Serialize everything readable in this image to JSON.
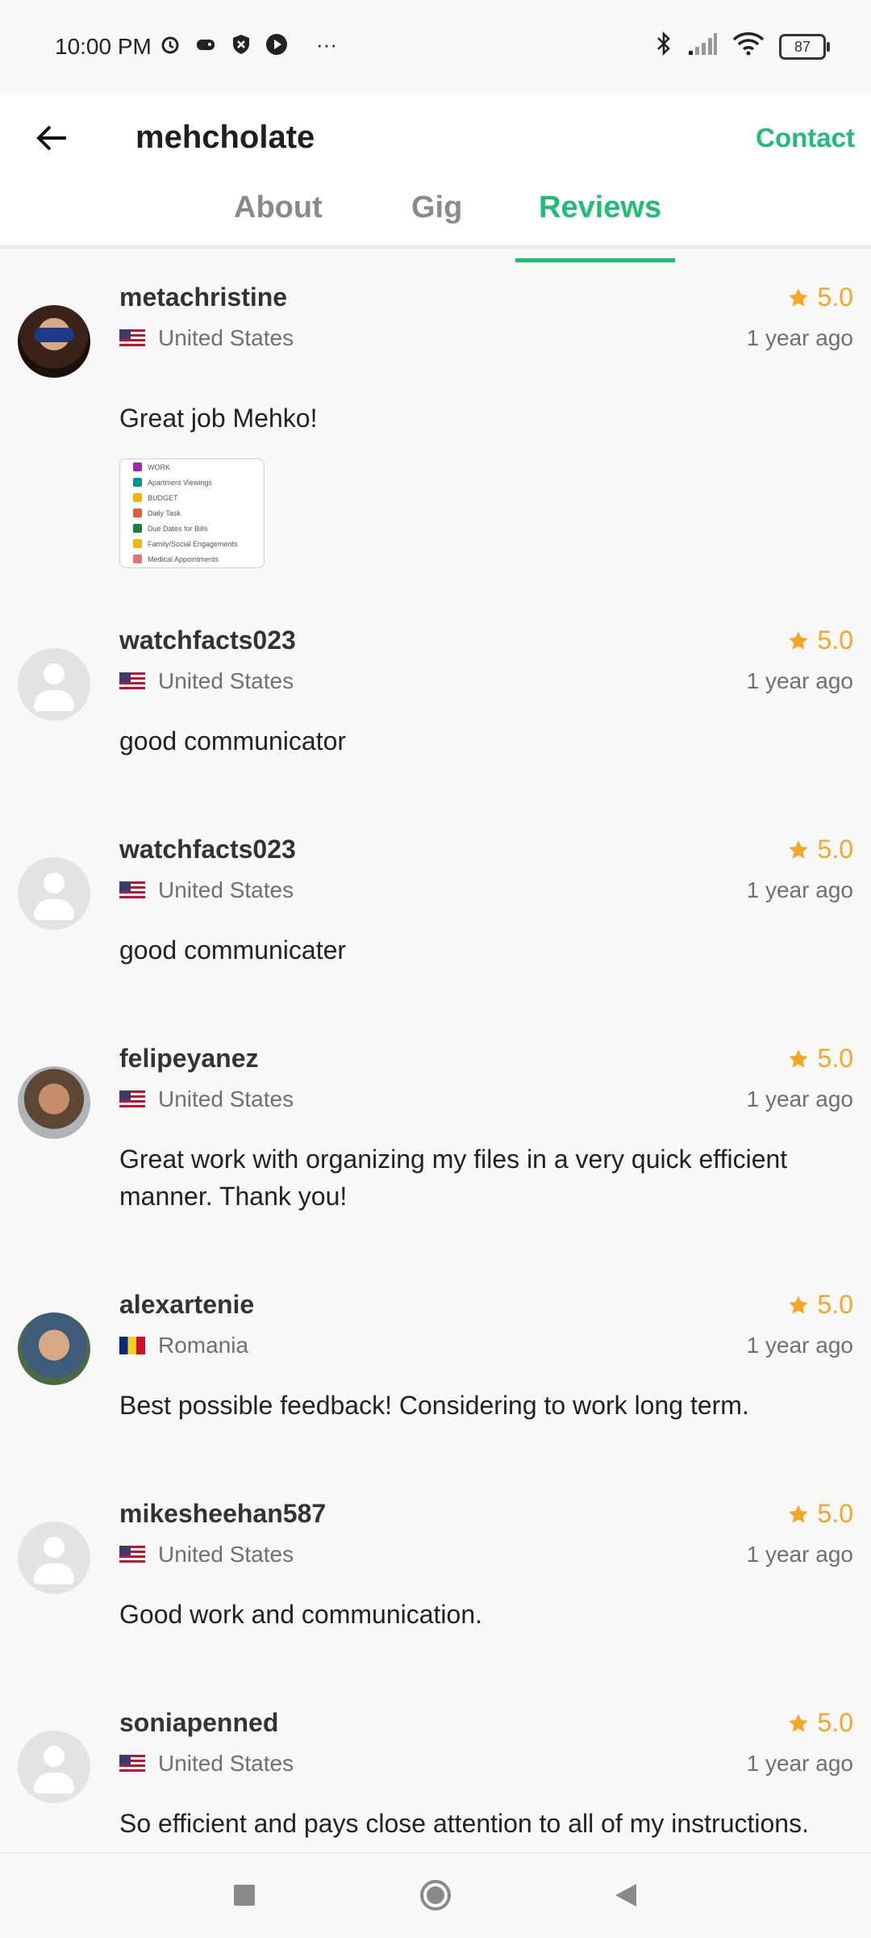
{
  "status_bar": {
    "time": "10:00 PM",
    "battery": "87",
    "more": "···"
  },
  "header": {
    "title": "mehcholate",
    "contact_label": "Contact"
  },
  "tabs": [
    {
      "label": "About",
      "active": false
    },
    {
      "label": "Gig",
      "active": false
    },
    {
      "label": "Reviews",
      "active": true
    }
  ],
  "colors": {
    "accent": "#1dbf73",
    "star": "#f6a623"
  },
  "attachment": {
    "items": [
      {
        "label": "WORK",
        "color": "#9c27b0"
      },
      {
        "label": "Apartment Viewings",
        "color": "#009688"
      },
      {
        "label": "BUDGET",
        "color": "#f4b400"
      },
      {
        "label": "Daily Task",
        "color": "#e35d2f"
      },
      {
        "label": "Due Dates for Bills",
        "color": "#1b7f3b"
      },
      {
        "label": "Family/Social Engagements",
        "color": "#f4b400"
      },
      {
        "label": "Medical Appointments",
        "color": "#e57373"
      }
    ]
  },
  "reviews": [
    {
      "username": "metachristine",
      "country": "United States",
      "flag": "us",
      "rating": "5.0",
      "time": "1 year ago",
      "text": "Great job Mehko!",
      "avatar": "photo1",
      "has_attachment": true
    },
    {
      "username": "watchfacts023",
      "country": "United States",
      "flag": "us",
      "rating": "5.0",
      "time": "1 year ago",
      "text": "good communicator",
      "avatar": "default"
    },
    {
      "username": "watchfacts023",
      "country": "United States",
      "flag": "us",
      "rating": "5.0",
      "time": "1 year ago",
      "text": "good communicater",
      "avatar": "default"
    },
    {
      "username": "felipeyanez",
      "country": "United States",
      "flag": "us",
      "rating": "5.0",
      "time": "1 year ago",
      "text": "Great work with organizing my files in a very quick efficient manner. Thank you!",
      "avatar": "photo2"
    },
    {
      "username": "alexartenie",
      "country": "Romania",
      "flag": "ro",
      "rating": "5.0",
      "time": "1 year ago",
      "text": "Best possible feedback! Considering to work long term.",
      "avatar": "photo3"
    },
    {
      "username": "mikesheehan587",
      "country": "United States",
      "flag": "us",
      "rating": "5.0",
      "time": "1 year ago",
      "text": "Good work and communication.",
      "avatar": "default"
    },
    {
      "username": "soniapenned",
      "country": "United States",
      "flag": "us",
      "rating": "5.0",
      "time": "1 year ago",
      "text": "So efficient and pays close attention to all of my instructions.",
      "avatar": "default"
    }
  ]
}
